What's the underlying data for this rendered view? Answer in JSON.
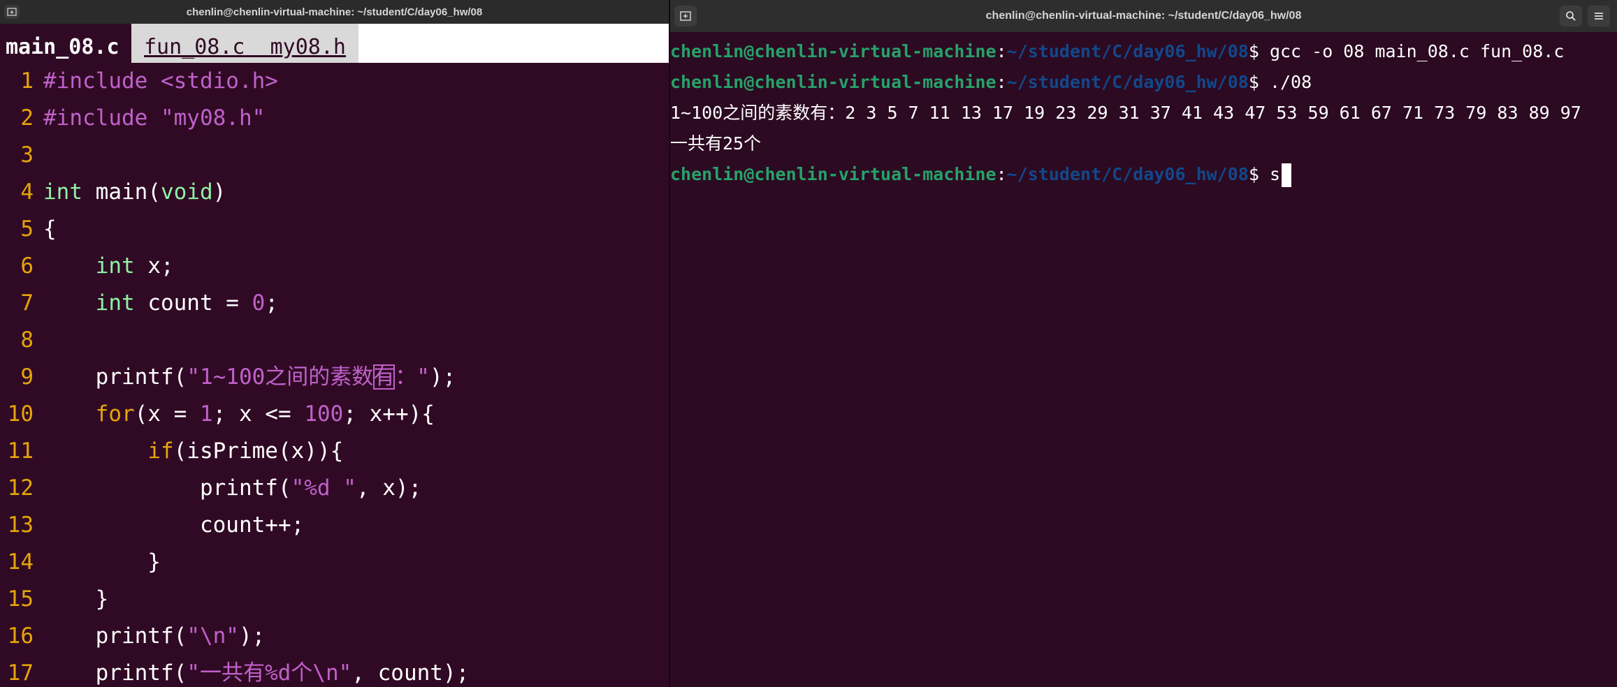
{
  "editor": {
    "window_title": "chenlin@chenlin-virtual-machine: ~/student/C/day06_hw/08",
    "active_tab": "main_08.c",
    "other_tabs": "fun_08.c  my08.h",
    "lines": [
      {
        "num": "1",
        "segs": [
          {
            "c": "pp",
            "t": "#include "
          },
          {
            "c": "str",
            "t": "<stdio.h>"
          }
        ]
      },
      {
        "num": "2",
        "segs": [
          {
            "c": "pp",
            "t": "#include "
          },
          {
            "c": "str",
            "t": "\"my08.h\""
          }
        ]
      },
      {
        "num": "3",
        "segs": []
      },
      {
        "num": "4",
        "segs": [
          {
            "c": "ty",
            "t": "int"
          },
          {
            "c": "",
            "t": " main("
          },
          {
            "c": "ty",
            "t": "void"
          },
          {
            "c": "",
            "t": ")"
          }
        ]
      },
      {
        "num": "5",
        "segs": [
          {
            "c": "",
            "t": "{"
          }
        ]
      },
      {
        "num": "6",
        "segs": [
          {
            "c": "",
            "t": "    "
          },
          {
            "c": "ty",
            "t": "int"
          },
          {
            "c": "",
            "t": " x;"
          }
        ]
      },
      {
        "num": "7",
        "segs": [
          {
            "c": "",
            "t": "    "
          },
          {
            "c": "ty",
            "t": "int"
          },
          {
            "c": "",
            "t": " count = "
          },
          {
            "c": "str",
            "t": "0"
          },
          {
            "c": "",
            "t": ";"
          }
        ]
      },
      {
        "num": "8",
        "segs": []
      },
      {
        "num": "9",
        "segs": [
          {
            "c": "",
            "t": "    printf("
          },
          {
            "c": "str",
            "t": "\"1~100之间的素数"
          },
          {
            "c": "str cursor-box",
            "t": "有"
          },
          {
            "c": "str",
            "t": "："
          },
          {
            "c": "str",
            "t": "\""
          },
          {
            "c": "",
            "t": ");"
          }
        ]
      },
      {
        "num": "10",
        "segs": [
          {
            "c": "",
            "t": "    "
          },
          {
            "c": "kw",
            "t": "for"
          },
          {
            "c": "",
            "t": "(x = "
          },
          {
            "c": "str",
            "t": "1"
          },
          {
            "c": "",
            "t": "; x <= "
          },
          {
            "c": "str",
            "t": "100"
          },
          {
            "c": "",
            "t": "; x++){"
          }
        ]
      },
      {
        "num": "11",
        "segs": [
          {
            "c": "",
            "t": "        "
          },
          {
            "c": "kw",
            "t": "if"
          },
          {
            "c": "",
            "t": "(isPrime(x)){"
          }
        ]
      },
      {
        "num": "12",
        "segs": [
          {
            "c": "",
            "t": "            printf("
          },
          {
            "c": "str",
            "t": "\"%d \""
          },
          {
            "c": "",
            "t": ", x);"
          }
        ]
      },
      {
        "num": "13",
        "segs": [
          {
            "c": "",
            "t": "            count++;"
          }
        ]
      },
      {
        "num": "14",
        "segs": [
          {
            "c": "",
            "t": "        }"
          }
        ]
      },
      {
        "num": "15",
        "segs": [
          {
            "c": "",
            "t": "    }"
          }
        ]
      },
      {
        "num": "16",
        "segs": [
          {
            "c": "",
            "t": "    printf("
          },
          {
            "c": "str",
            "t": "\"\\n\""
          },
          {
            "c": "",
            "t": ");"
          }
        ]
      },
      {
        "num": "17",
        "segs": [
          {
            "c": "",
            "t": "    printf("
          },
          {
            "c": "str",
            "t": "\"一共有%d个\\n\""
          },
          {
            "c": "",
            "t": ", count);"
          }
        ]
      }
    ]
  },
  "terminal": {
    "window_title": "chenlin@chenlin-virtual-machine: ~/student/C/day06_hw/08",
    "prompt_user": "chenlin@chenlin-virtual-machine",
    "prompt_sep": ":",
    "prompt_dir": "~/student/C/day06_hw/08",
    "lines": [
      {
        "type": "prompt",
        "cmd": "$ gcc -o 08 main_08.c fun_08.c"
      },
      {
        "type": "prompt",
        "cmd": "$ ./08"
      },
      {
        "type": "output",
        "text": "1~100之间的素数有：2 3 5 7 11 13 17 19 23 29 31 37 41 43 47 53 59 61 67 71 73 79 83 89 97"
      },
      {
        "type": "output",
        "text": "一共有25个"
      },
      {
        "type": "prompt",
        "cmd": "$ s"
      }
    ]
  },
  "icons": {
    "new_tab": "new-tab-icon",
    "search": "search-icon",
    "menu": "hamburger-menu-icon"
  },
  "colors": {
    "background": "#300a24",
    "prompt_user": "#26a269",
    "prompt_dir": "#12488b",
    "line_number": "#e5a50a",
    "string": "#c061cb",
    "type": "#8ff0a4"
  }
}
